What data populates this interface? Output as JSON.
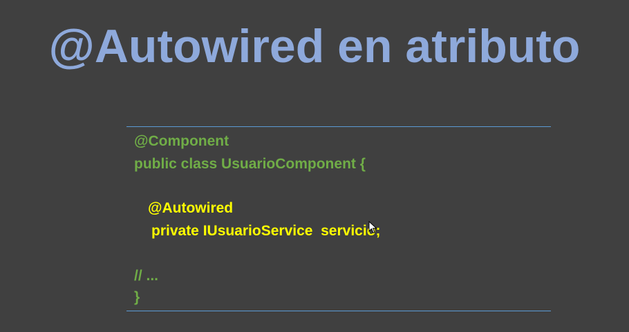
{
  "slide": {
    "title": "@Autowired en atributo",
    "code_lines": {
      "l1": "@Component",
      "l2": "public class UsuarioComponent {",
      "l3": "@Autowired",
      "l4": "private IUsuarioService  servicio;",
      "l5": "// ...",
      "l6": "}"
    },
    "colors": {
      "background": "#404040",
      "title": "#8ea9db",
      "code_green": "#70ad47",
      "code_yellow": "#ffff00",
      "rule": "#5b9bd5"
    },
    "cursor_icon": "mouse-pointer-icon"
  }
}
